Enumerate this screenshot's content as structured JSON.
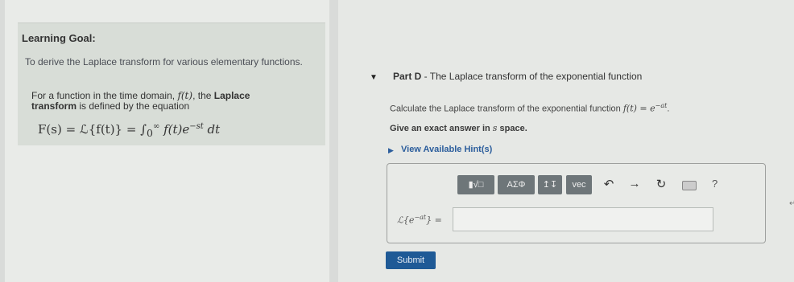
{
  "learning_goal": {
    "title": "Learning Goal:",
    "goal_text": "To derive the Laplace transform for various elementary functions.",
    "def_prefix": "For a function in the time domain, ",
    "def_func": "f(t)",
    "def_mid": ", the ",
    "def_bold1": "Laplace",
    "def_bold2": "transform",
    "def_suffix": " is defined by the equation",
    "eq_lhs": "F(s) = ℒ{f(t)} = ∫",
    "eq_sub": "0",
    "eq_sup": "∞",
    "eq_body": " f(t)e",
    "eq_exp": "−st",
    "eq_dt": " dt"
  },
  "part": {
    "caret": "▼",
    "label_bold": "Part D",
    "label_sep": " - ",
    "label_text": "The Laplace transform of the exponential function"
  },
  "instruction": {
    "text": "Calculate the Laplace transform of the exponential function ",
    "func": "f(t) = e",
    "exp": "−at",
    "end": "."
  },
  "exact": {
    "text": "Give an exact answer in ",
    "var": "s",
    "end": " space."
  },
  "hints": {
    "caret": "▶",
    "label": "View Available Hint(s)"
  },
  "toolbar": {
    "templates_label": "▮√□",
    "symbols_label": "AΣΦ",
    "subsup_label": "↥↧",
    "vec_label": "vec",
    "undo_icon": "↶",
    "redo_icon": "→",
    "reset_icon": "↻",
    "help_icon": "?"
  },
  "answer": {
    "label_pre": "ℒ{e",
    "label_exp": "−at",
    "label_post": "} =",
    "value": ""
  },
  "submit": {
    "label": "Submit"
  },
  "colors": {
    "accent": "#1f5a96",
    "link": "#2b5d9c",
    "toolbar_button": "#6e7679"
  }
}
